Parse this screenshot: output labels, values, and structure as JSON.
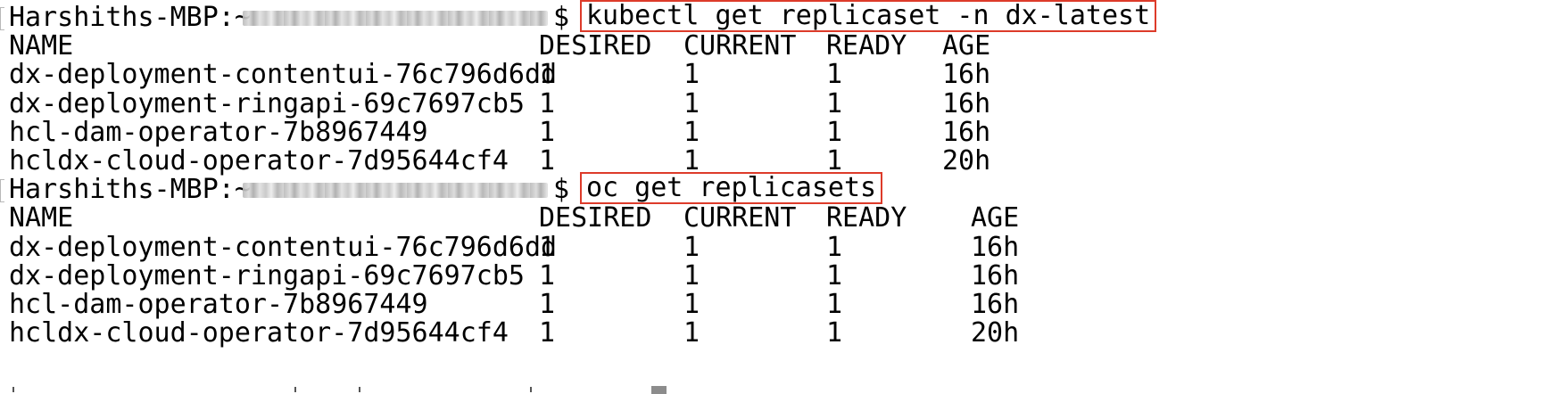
{
  "prompt": {
    "host": "Harshiths-MBP:~",
    "symbol": "$"
  },
  "blocks": [
    {
      "command": "kubectl get replicaset -n dx-latest",
      "headers": [
        "NAME",
        "DESIRED",
        "CURRENT",
        "READY",
        "AGE"
      ],
      "rows": [
        [
          "dx-deployment-contentui-76c796d6dd",
          "1",
          "1",
          "1",
          "16h"
        ],
        [
          "dx-deployment-ringapi-69c7697cb5",
          "1",
          "1",
          "1",
          "16h"
        ],
        [
          "hcl-dam-operator-7b8967449",
          "1",
          "1",
          "1",
          "16h"
        ],
        [
          "hcldx-cloud-operator-7d95644cf4",
          "1",
          "1",
          "1",
          "20h"
        ]
      ]
    },
    {
      "command": "oc get replicasets",
      "headers": [
        "NAME",
        "DESIRED",
        "CURRENT",
        "READY",
        "AGE"
      ],
      "rows": [
        [
          "dx-deployment-contentui-76c796d6dd",
          "1",
          "1",
          "1",
          "16h"
        ],
        [
          "dx-deployment-ringapi-69c7697cb5",
          "1",
          "1",
          "1",
          "16h"
        ],
        [
          "hcl-dam-operator-7b8967449",
          "1",
          "1",
          "1",
          "16h"
        ],
        [
          "hcldx-cloud-operator-7d95644cf4",
          "1",
          "1",
          "1",
          "20h"
        ]
      ]
    }
  ],
  "colors": {
    "text": "#000000",
    "background": "#ffffff",
    "highlight_border": "#dd3b2a",
    "redaction": "#c4c4c4"
  }
}
